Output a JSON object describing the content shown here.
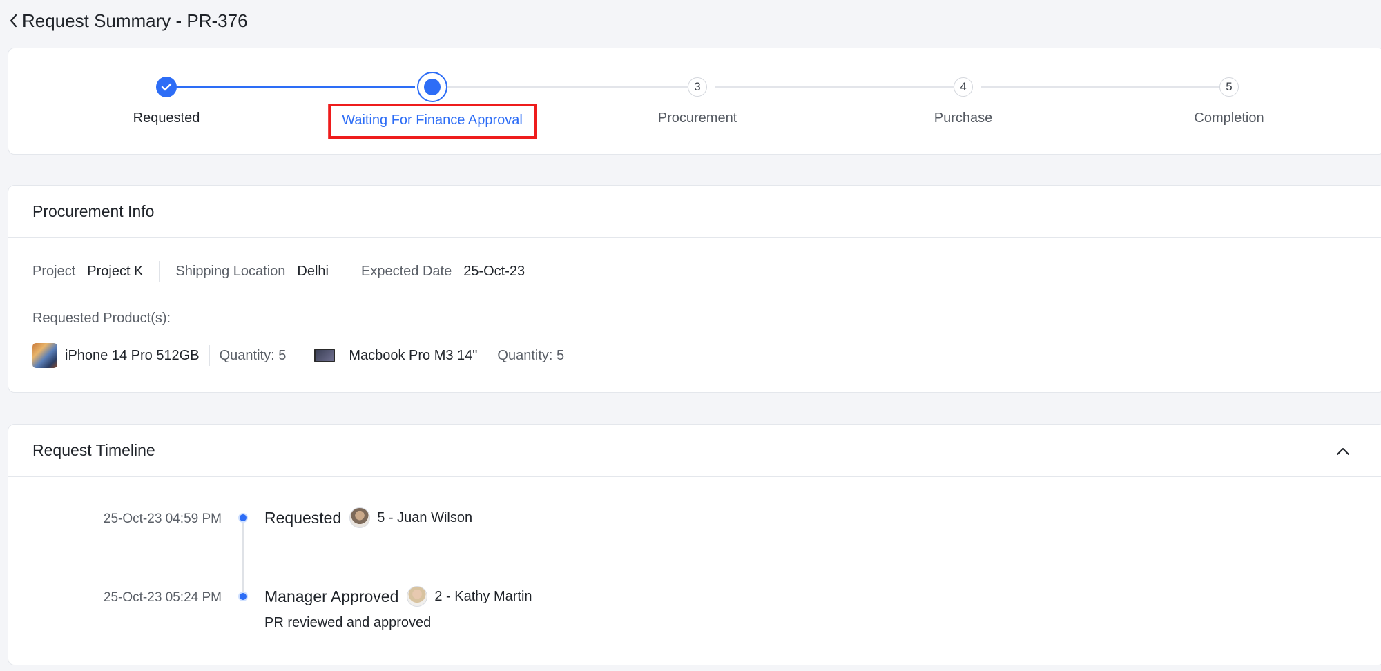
{
  "header": {
    "title": "Request Summary - PR-376"
  },
  "stepper": {
    "steps": [
      {
        "label": "Requested",
        "number": "1",
        "state": "done"
      },
      {
        "label": "Waiting For Finance Approval",
        "number": "2",
        "state": "current"
      },
      {
        "label": "Procurement",
        "number": "3",
        "state": "pending"
      },
      {
        "label": "Purchase",
        "number": "4",
        "state": "pending"
      },
      {
        "label": "Completion",
        "number": "5",
        "state": "pending"
      }
    ]
  },
  "procurement_info": {
    "title": "Procurement Info",
    "project_label": "Project",
    "project_value": "Project K",
    "shipping_label": "Shipping Location",
    "shipping_value": "Delhi",
    "date_label": "Expected Date",
    "date_value": "25-Oct-23",
    "products_label": "Requested Product(s):",
    "products": [
      {
        "name": "iPhone 14 Pro 512GB",
        "quantity": "Quantity: 5"
      },
      {
        "name": "Macbook Pro M3 14\"",
        "quantity": "Quantity: 5"
      }
    ]
  },
  "timeline": {
    "title": "Request Timeline",
    "events": [
      {
        "time": "25-Oct-23 04:59 PM",
        "title": "Requested",
        "user": "5 - Juan Wilson",
        "note": ""
      },
      {
        "time": "25-Oct-23 05:24 PM",
        "title": "Manager Approved",
        "user": "2 - Kathy Martin",
        "note": "PR reviewed and approved"
      }
    ]
  },
  "colors": {
    "accent": "#2d6df6",
    "highlight_border": "#ee1c1c"
  },
  "icons": {
    "back": "chevron-left-icon",
    "collapse": "chevron-up-icon",
    "done": "check-icon"
  }
}
